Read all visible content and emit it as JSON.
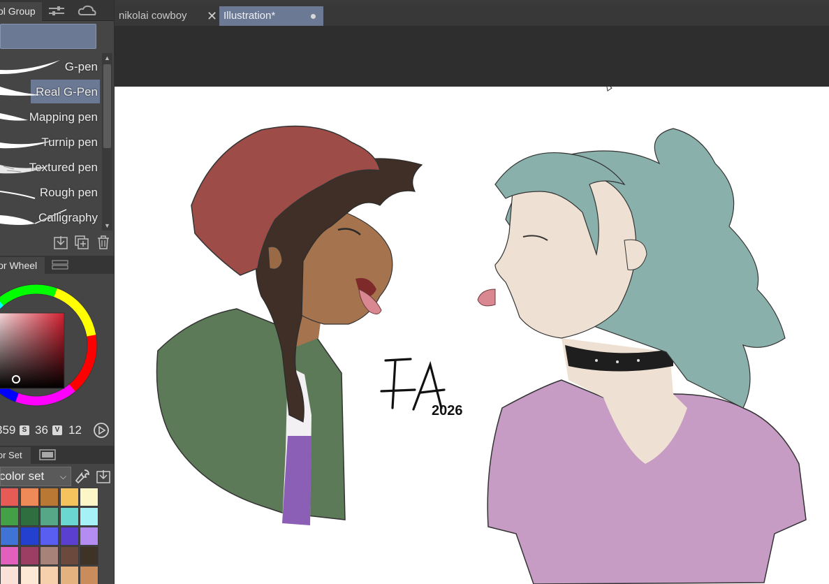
{
  "tool_group": {
    "tab_label": "ol Group"
  },
  "brushes": [
    {
      "label": "G-pen",
      "selected": false
    },
    {
      "label": "Real G-Pen",
      "selected": true
    },
    {
      "label": "Mapping pen",
      "selected": false
    },
    {
      "label": "Turnip pen",
      "selected": false
    },
    {
      "label": "Textured pen",
      "selected": false
    },
    {
      "label": "Rough pen",
      "selected": false
    },
    {
      "label": "Calligraphy",
      "selected": false
    }
  ],
  "color_wheel": {
    "tab_label": "lor Wheel",
    "h": "359",
    "s_badge": "S",
    "s": "36",
    "v_badge": "V",
    "v": "12"
  },
  "color_set": {
    "tab_label": "lor Set",
    "dropdown_value": "color set",
    "swatches": [
      "#e65b55",
      "#ee8a57",
      "#b97834",
      "#f4c35d",
      "#fdf7c8",
      "#43a047",
      "#2e6e3f",
      "#55a788",
      "#6ad8d1",
      "#a6f1f5",
      "#3f73d6",
      "#2440cf",
      "#5a5ef0",
      "#5a3fd0",
      "#b48cf2",
      "#e35fbd",
      "#9c3d63",
      "#a78279",
      "#6b4a3d",
      "#3f3226",
      "#fbe2d8",
      "#fde8d6",
      "#f6cfad",
      "#e3b27f",
      "#c98c5a"
    ]
  },
  "document_tabs": [
    {
      "label": "nikolai cowboy",
      "active": false
    },
    {
      "label": "Illustration*",
      "active": true
    }
  ],
  "artwork": {
    "signature": "FA",
    "year": "2026"
  },
  "colors": {
    "accent": "#6b7995",
    "panel": "#454545",
    "canvas_bg": "#2e2e2e"
  }
}
